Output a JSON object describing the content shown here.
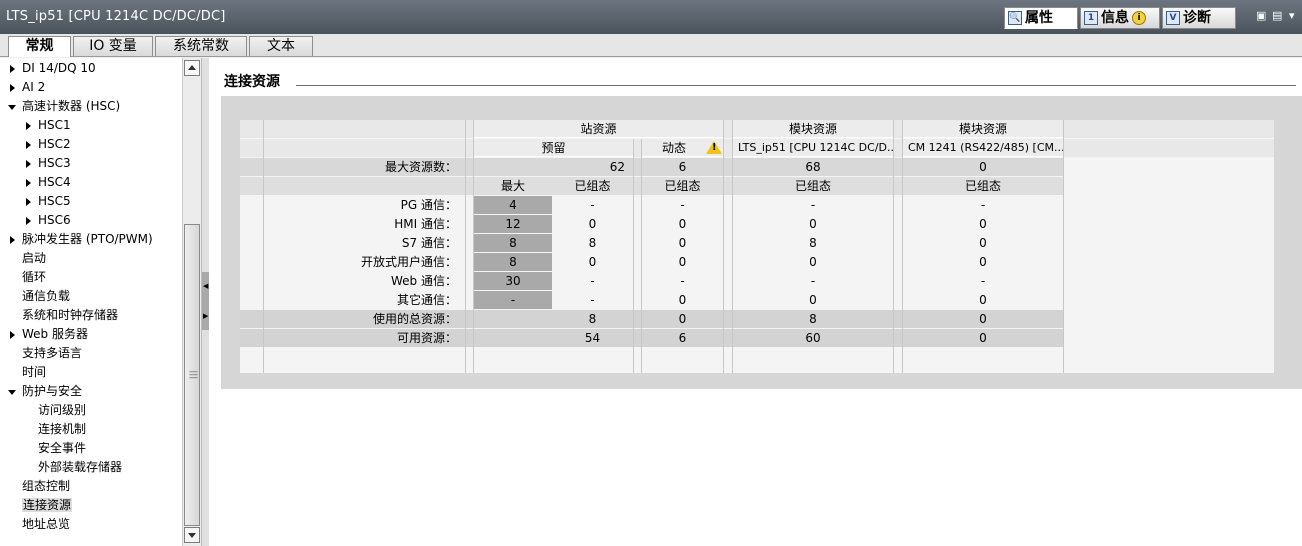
{
  "window": {
    "title": "LTS_ip51 [CPU 1214C DC/DC/DC]",
    "inspector_tabs": [
      {
        "label": "属性",
        "icon": "properties-icon",
        "active": true
      },
      {
        "label": "信息",
        "icon": "info-list-icon",
        "active": false
      },
      {
        "label": "诊断",
        "icon": "diagnostics-icon",
        "active": false
      }
    ]
  },
  "main_tabs": [
    "常规",
    "IO 变量",
    "系统常数",
    "文本"
  ],
  "sidebar": {
    "items": [
      {
        "label": "DI 14/DQ 10",
        "level": 0,
        "arrow": "right"
      },
      {
        "label": "AI 2",
        "level": 0,
        "arrow": "right"
      },
      {
        "label": "高速计数器 (HSC)",
        "level": 0,
        "arrow": "down"
      },
      {
        "label": "HSC1",
        "level": 1,
        "arrow": "right"
      },
      {
        "label": "HSC2",
        "level": 1,
        "arrow": "right"
      },
      {
        "label": "HSC3",
        "level": 1,
        "arrow": "right"
      },
      {
        "label": "HSC4",
        "level": 1,
        "arrow": "right"
      },
      {
        "label": "HSC5",
        "level": 1,
        "arrow": "right"
      },
      {
        "label": "HSC6",
        "level": 1,
        "arrow": "right"
      },
      {
        "label": "脉冲发生器 (PTO/PWM)",
        "level": 0,
        "arrow": "right"
      },
      {
        "label": "启动",
        "level": 0,
        "arrow": ""
      },
      {
        "label": "循环",
        "level": 0,
        "arrow": ""
      },
      {
        "label": "通信负载",
        "level": 0,
        "arrow": ""
      },
      {
        "label": "系统和时钟存储器",
        "level": 0,
        "arrow": ""
      },
      {
        "label": "Web 服务器",
        "level": 0,
        "arrow": "right"
      },
      {
        "label": "支持多语言",
        "level": 0,
        "arrow": ""
      },
      {
        "label": "时间",
        "level": 0,
        "arrow": ""
      },
      {
        "label": "防护与安全",
        "level": 0,
        "arrow": "down"
      },
      {
        "label": "访问级别",
        "level": 1,
        "arrow": ""
      },
      {
        "label": "连接机制",
        "level": 1,
        "arrow": ""
      },
      {
        "label": "安全事件",
        "level": 1,
        "arrow": ""
      },
      {
        "label": "外部装载存储器",
        "level": 1,
        "arrow": ""
      },
      {
        "label": "组态控制",
        "level": 0,
        "arrow": ""
      },
      {
        "label": "连接资源",
        "level": 0,
        "arrow": "",
        "selected": true
      },
      {
        "label": "地址总览",
        "level": 0,
        "arrow": ""
      }
    ]
  },
  "section": {
    "title": "连接资源"
  },
  "table": {
    "group_headers": {
      "station": "站资源",
      "module1": "模块资源",
      "module2": "模块资源"
    },
    "sub_headers": {
      "reserved": "预留",
      "dynamic": "动态",
      "module1_name": "LTS_ip51 [CPU 1214C DC/D...",
      "module2_name": "CM 1241 (RS422/485) [CM..."
    },
    "max_row": {
      "label": "最大资源数：",
      "reserved": "62",
      "dynamic": "6",
      "module1": "68",
      "module2": "0"
    },
    "col_headers": {
      "max": "最大",
      "configured_reserved": "已组态",
      "configured_dynamic": "已组态",
      "configured_module1": "已组态",
      "configured_module2": "已组态"
    },
    "rows": [
      {
        "label": "PG 通信：",
        "max": "4",
        "cfg": "-",
        "dyn": "-",
        "m1": "-",
        "m2": "-"
      },
      {
        "label": "HMI 通信：",
        "max": "12",
        "cfg": "0",
        "dyn": "0",
        "m1": "0",
        "m2": "0"
      },
      {
        "label": "S7 通信：",
        "max": "8",
        "cfg": "8",
        "dyn": "0",
        "m1": "8",
        "m2": "0"
      },
      {
        "label": "开放式用户通信：",
        "max": "8",
        "cfg": "0",
        "dyn": "0",
        "m1": "0",
        "m2": "0"
      },
      {
        "label": "Web 通信：",
        "max": "30",
        "cfg": "-",
        "dyn": "-",
        "m1": "-",
        "m2": "-"
      },
      {
        "label": "其它通信：",
        "max": "-",
        "cfg": "-",
        "dyn": "0",
        "m1": "0",
        "m2": "0"
      },
      {
        "label": "使用的总资源：",
        "max": "",
        "cfg": "8",
        "dyn": "0",
        "m1": "8",
        "m2": "0"
      },
      {
        "label": "可用资源：",
        "max": "",
        "cfg": "54",
        "dyn": "6",
        "m1": "60",
        "m2": "0"
      }
    ]
  },
  "colors": {
    "max_cell": "#a9a9a9",
    "selected": "#dcdcdc",
    "panel": "#d6d6d6"
  }
}
